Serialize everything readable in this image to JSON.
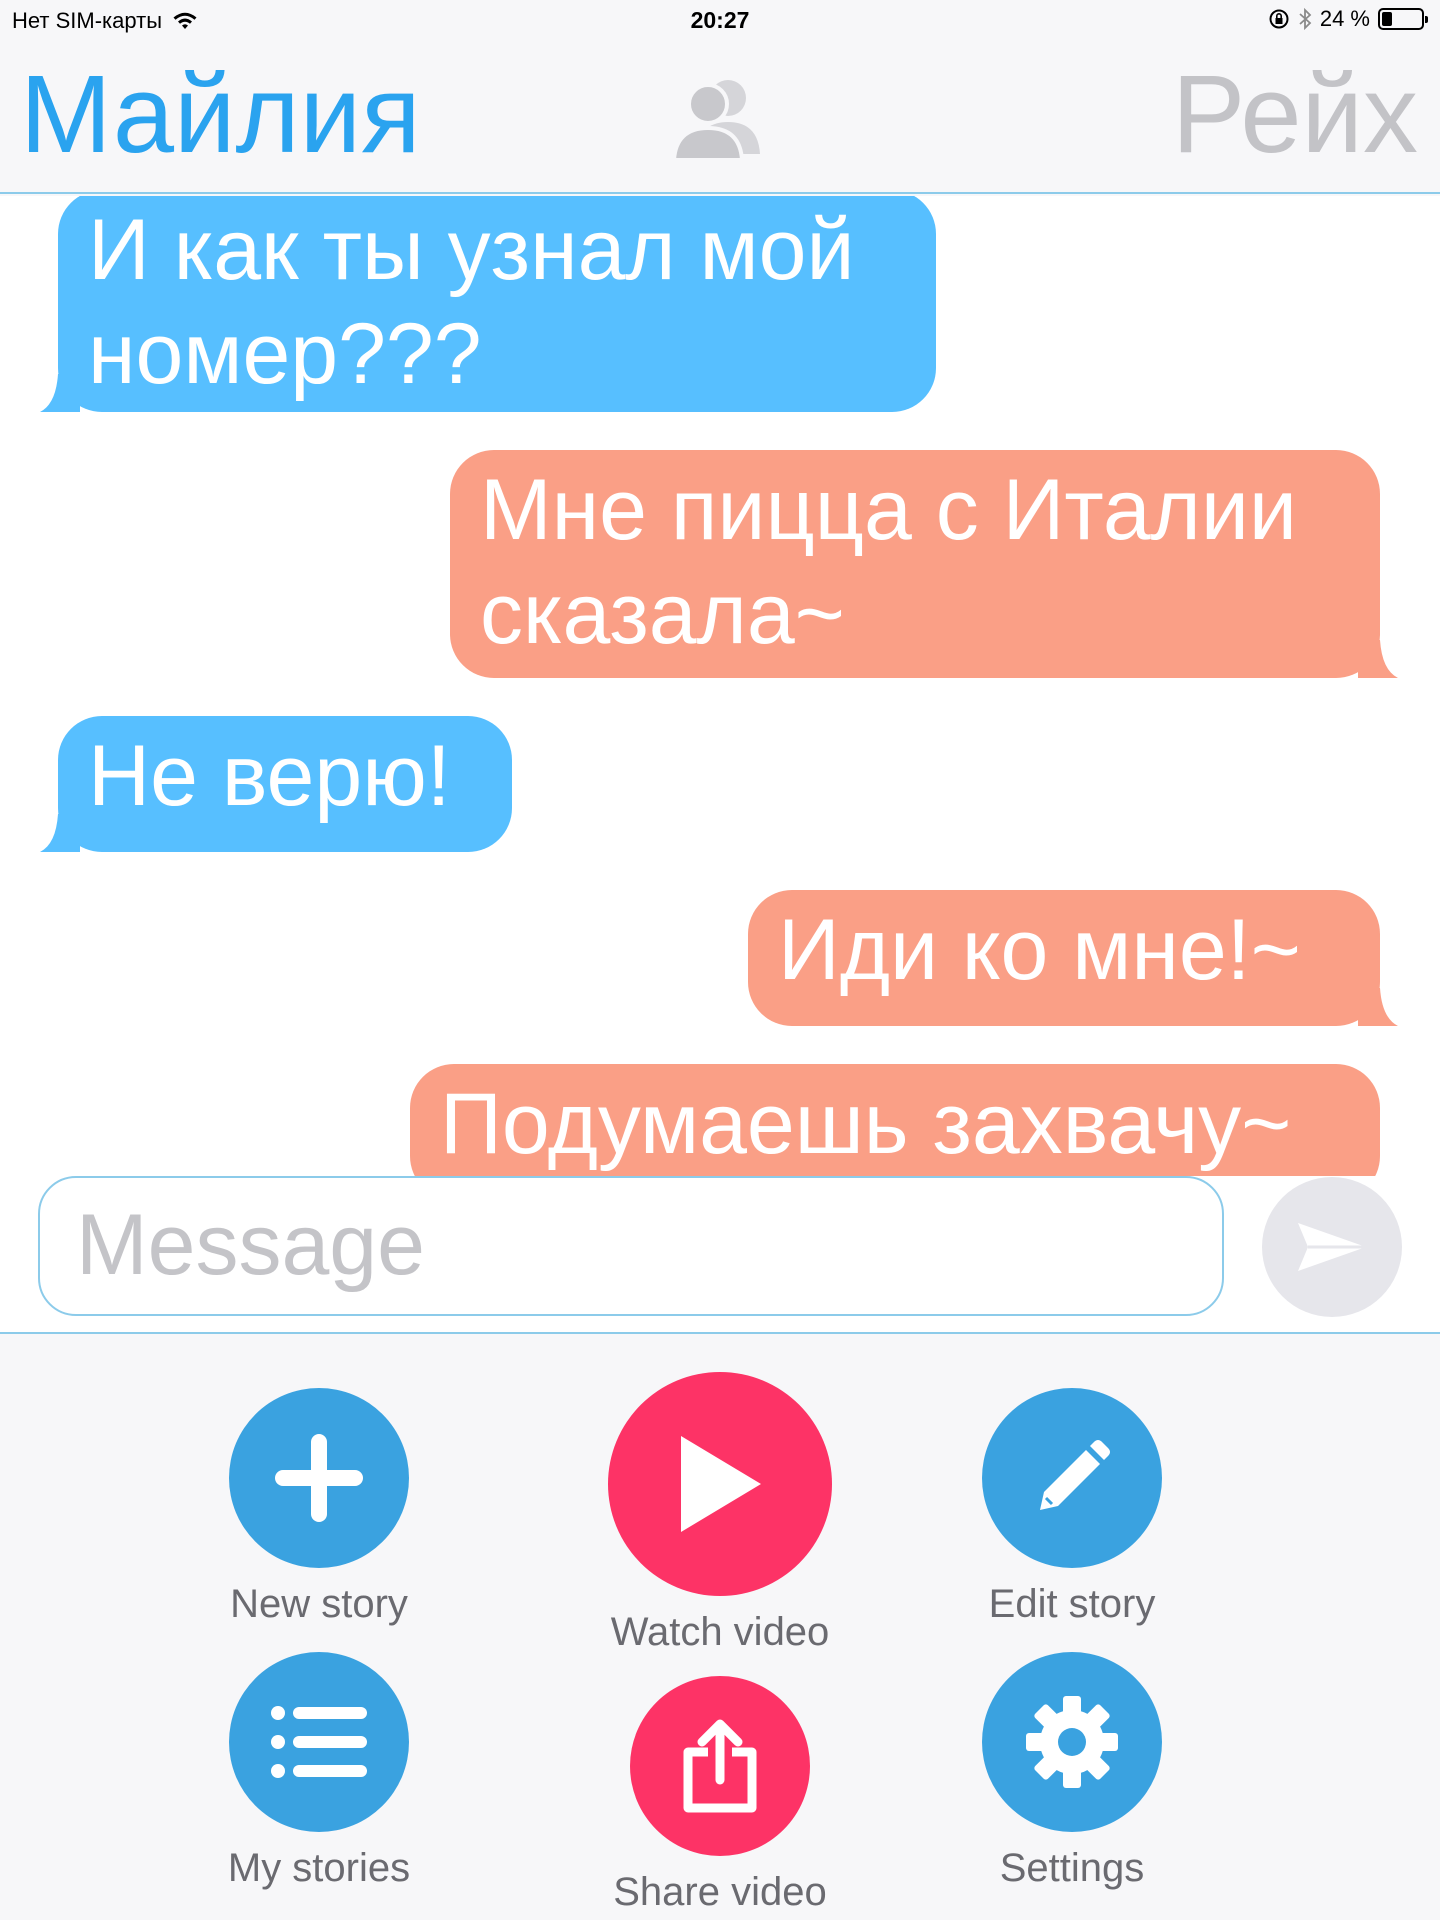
{
  "status_bar": {
    "carrier": "Нет SIM-карты",
    "time": "20:27",
    "battery_percent": "24 %",
    "battery_level": 0.24
  },
  "header": {
    "left_name": "Майлия",
    "right_name": "Рейх",
    "center_icon": "contacts-icon"
  },
  "messages": [
    {
      "side": "left",
      "text": "И как ты узнал мой номер???"
    },
    {
      "side": "right",
      "text": "Мне пицца с Италии сказала~"
    },
    {
      "side": "left",
      "text": "Не верю!"
    },
    {
      "side": "right",
      "text": "Иди ко мне!~"
    },
    {
      "side": "right",
      "text": "Подумаешь захвачу~"
    }
  ],
  "composer": {
    "placeholder": "Message",
    "send_icon": "send-icon"
  },
  "actions": {
    "new_story": {
      "label": "New story",
      "icon": "plus-icon"
    },
    "watch_video": {
      "label": "Watch video",
      "icon": "play-icon"
    },
    "edit_story": {
      "label": "Edit story",
      "icon": "pencil-icon"
    },
    "my_stories": {
      "label": "My stories",
      "icon": "list-icon"
    },
    "share_video": {
      "label": "Share video",
      "icon": "share-icon"
    },
    "settings": {
      "label": "Settings",
      "icon": "gear-icon"
    }
  },
  "colors": {
    "accent_blue": "#2aa3ef",
    "bubble_left": "#57bfff",
    "bubble_right": "#fa9f86",
    "action_blue": "#3aa2e0",
    "action_red": "#fd3366"
  }
}
